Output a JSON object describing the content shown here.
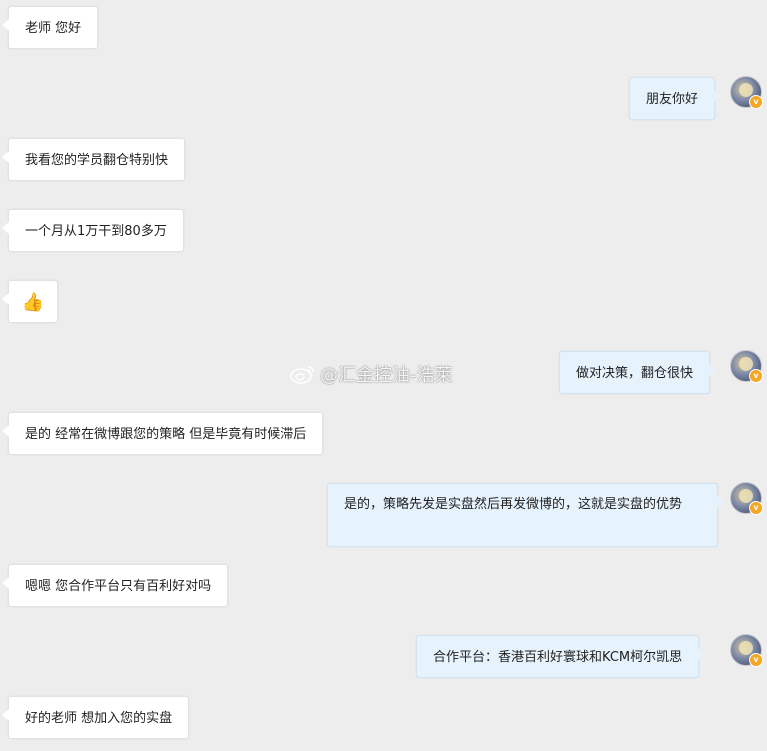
{
  "messages": [
    {
      "side": "in",
      "text": "老师 您好"
    },
    {
      "side": "out",
      "text": "朋友你好",
      "avatar": "verified-avatar"
    },
    {
      "side": "in",
      "text": "我看您的学员翻仓特别快"
    },
    {
      "side": "in",
      "text": "一个月从1万干到80多万"
    },
    {
      "side": "in",
      "text": "👍"
    },
    {
      "side": "out",
      "text": "做对决策，翻仓很快",
      "avatar": "verified-avatar"
    },
    {
      "side": "in",
      "text": "是的 经常在微博跟您的策略 但是毕竟有时候滞后"
    },
    {
      "side": "out",
      "text": "是的，策略先发是实盘然后再发微博的，这就是实盘的优势",
      "avatar": "verified-avatar"
    },
    {
      "side": "in",
      "text": "嗯嗯 您合作平台只有百利好对吗"
    },
    {
      "side": "out",
      "text": "合作平台：香港百利好寰球和KCM柯尔凯思",
      "avatar": "verified-avatar"
    },
    {
      "side": "in",
      "text": "好的老师 想加入您的实盘"
    }
  ],
  "watermark": {
    "text": "@汇金控油-浩莱",
    "icon": "weibo-icon"
  },
  "colors": {
    "background": "#ededed",
    "incoming_bubble": "#ffffff",
    "outgoing_bubble": "#e6f2fc",
    "verified_badge": "#f5a623"
  }
}
